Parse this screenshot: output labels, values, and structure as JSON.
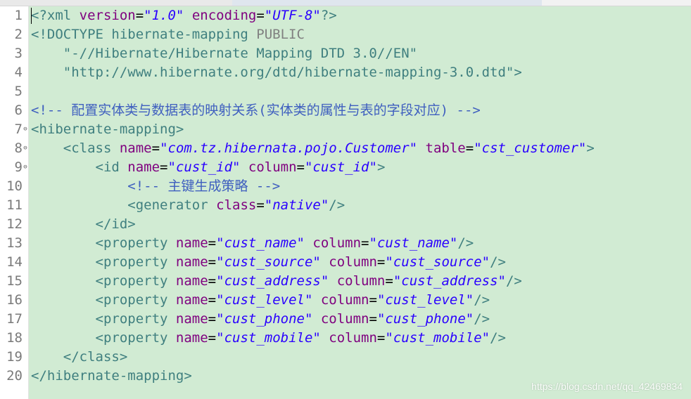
{
  "editor": {
    "colors": {
      "background": "#d1ebd3",
      "tag": "#3f7f7f",
      "attribute": "#7f007f",
      "value": "#2a00ff",
      "comment": "#3f5fbf"
    },
    "lines": [
      {
        "n": "1",
        "fold": "",
        "a": "<?xml ",
        "b": "version",
        "c": "=",
        "d": "\"1.0\"",
        "e": " encoding",
        "f": "=",
        "g": "\"UTF-8\"",
        "h": "?>"
      },
      {
        "n": "2",
        "fold": "",
        "tag": "<!DOCTYPE hibernate-mapping ",
        "kw": "PUBLIC"
      },
      {
        "n": "3",
        "fold": "",
        "str": "    \"-//Hibernate/Hibernate Mapping DTD 3.0//EN\""
      },
      {
        "n": "4",
        "fold": "",
        "str": "    \"http://www.hibernate.org/dtd/hibernate-mapping-3.0.dtd\">"
      },
      {
        "n": "5",
        "fold": ""
      },
      {
        "n": "6",
        "fold": "",
        "comment": "<!-- 配置实体类与数据表的映射关系(实体类的属性与表的字段对应) -->"
      },
      {
        "n": "7",
        "fold": "⊖",
        "tag": "<hibernate-mapping>"
      },
      {
        "n": "8",
        "fold": "⊖",
        "indent": "    ",
        "open": "<class ",
        "a1": "name",
        "v1": "\"com.tz.hibernata.pojo.Customer\"",
        "a2": " table",
        "v2": "\"cst_customer\"",
        "close": ">"
      },
      {
        "n": "9",
        "fold": "⊖",
        "indent": "        ",
        "open": "<id ",
        "a1": "name",
        "v1": "\"cust_id\"",
        "a2": " column",
        "v2": "\"cust_id\"",
        "close": ">"
      },
      {
        "n": "10",
        "fold": "",
        "comment": "            <!-- 主键生成策略 -->"
      },
      {
        "n": "11",
        "fold": "",
        "indent": "            ",
        "open": "<generator ",
        "a1": "class",
        "v1": "\"native\"",
        "close": "/>"
      },
      {
        "n": "12",
        "fold": "",
        "tag": "        </id>"
      },
      {
        "n": "13",
        "fold": "",
        "indent": "        ",
        "open": "<property ",
        "a1": "name",
        "v1": "\"cust_name\"",
        "a2": " column",
        "v2": "\"cust_name\"",
        "close": "/>"
      },
      {
        "n": "14",
        "fold": "",
        "indent": "        ",
        "open": "<property ",
        "a1": "name",
        "v1": "\"cust_source\"",
        "a2": " column",
        "v2": "\"cust_source\"",
        "close": "/>"
      },
      {
        "n": "15",
        "fold": "",
        "indent": "        ",
        "open": "<property ",
        "a1": "name",
        "v1": "\"cust_address\"",
        "a2": " column",
        "v2": "\"cust_address\"",
        "close": "/>"
      },
      {
        "n": "16",
        "fold": "",
        "indent": "        ",
        "open": "<property ",
        "a1": "name",
        "v1": "\"cust_level\"",
        "a2": " column",
        "v2": "\"cust_level\"",
        "close": "/>"
      },
      {
        "n": "17",
        "fold": "",
        "indent": "        ",
        "open": "<property ",
        "a1": "name",
        "v1": "\"cust_phone\"",
        "a2": " column",
        "v2": "\"cust_phone\"",
        "close": "/>"
      },
      {
        "n": "18",
        "fold": "",
        "indent": "        ",
        "open": "<property ",
        "a1": "name",
        "v1": "\"cust_mobile\"",
        "a2": " column",
        "v2": "\"cust_mobile\"",
        "close": "/>"
      },
      {
        "n": "19",
        "fold": "",
        "tag": "    </class>"
      },
      {
        "n": "20",
        "fold": "",
        "tag": "</hibernate-mapping>"
      }
    ]
  },
  "watermark": "https://blog.csdn.net/qq_42469834"
}
